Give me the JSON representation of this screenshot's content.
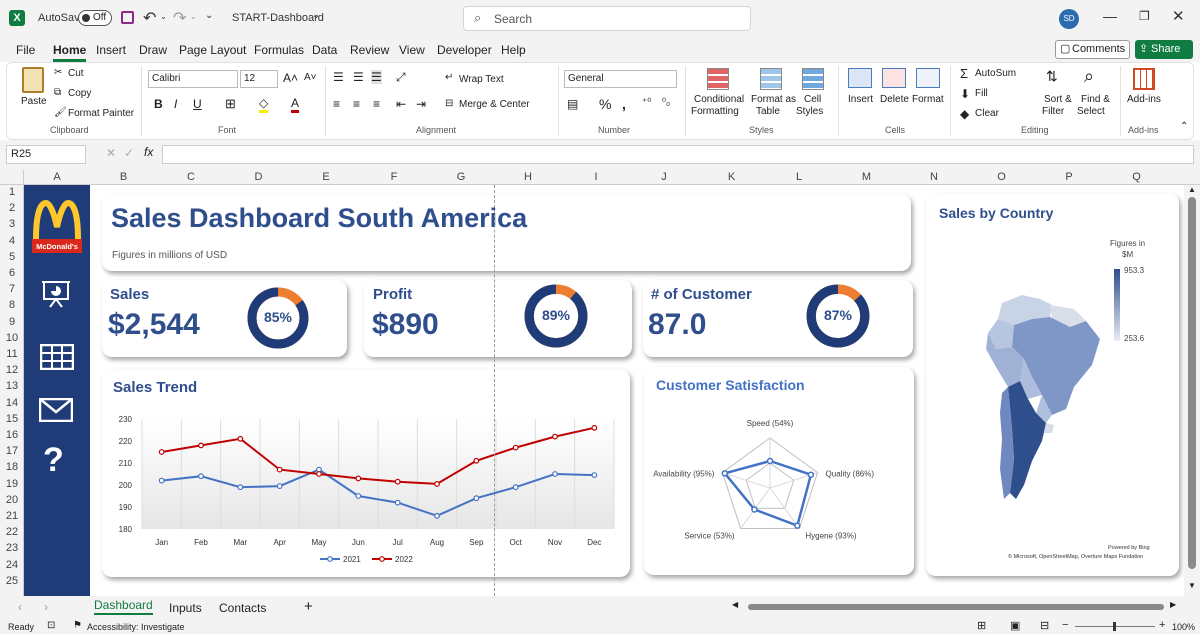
{
  "titlebar": {
    "autosave_label": "AutoSave",
    "autosave_state": "Off",
    "doc_title": "START-Dashboard",
    "search_placeholder": "Search",
    "user_initials": "SD"
  },
  "menu": [
    "File",
    "Home",
    "Insert",
    "Draw",
    "Page Layout",
    "Formulas",
    "Data",
    "Review",
    "View",
    "Developer",
    "Help"
  ],
  "menu_right": {
    "comments": "Comments",
    "share": "Share"
  },
  "ribbon": {
    "clipboard": {
      "paste": "Paste",
      "cut": "Cut",
      "copy": "Copy",
      "format_painter": "Format Painter",
      "group": "Clipboard"
    },
    "font": {
      "name": "Calibri",
      "size": "12",
      "group": "Font"
    },
    "alignment": {
      "wrap": "Wrap Text",
      "merge": "Merge & Center",
      "group": "Alignment"
    },
    "number": {
      "format": "General",
      "group": "Number"
    },
    "styles": {
      "conditional": "Conditional",
      "conditional2": "Formatting",
      "format_as": "Format as",
      "format_as2": "Table",
      "cell": "Cell",
      "cell2": "Styles",
      "group": "Styles"
    },
    "cells": {
      "insert": "Insert",
      "delete": "Delete",
      "format": "Format",
      "group": "Cells"
    },
    "editing": {
      "autosum": "AutoSum",
      "fill": "Fill",
      "clear": "Clear",
      "sort": "Sort &",
      "sort2": "Filter",
      "find": "Find &",
      "find2": "Select",
      "group": "Editing"
    },
    "addins": {
      "label": "Add-ins",
      "group": "Add-ins"
    }
  },
  "formula": {
    "namebox": "R25",
    "fx": "fx"
  },
  "columns": [
    "A",
    "B",
    "C",
    "D",
    "E",
    "F",
    "G",
    "H",
    "I",
    "J",
    "K",
    "L",
    "M",
    "N",
    "O",
    "P",
    "Q"
  ],
  "rows": [
    "1",
    "2",
    "3",
    "4",
    "5",
    "6",
    "7",
    "8",
    "9",
    "10",
    "11",
    "12",
    "13",
    "14",
    "15",
    "16",
    "17",
    "18",
    "19",
    "20",
    "21",
    "22",
    "23",
    "24",
    "25"
  ],
  "dashboard": {
    "logo_text": "McDonald's",
    "title": "Sales Dashboard South America",
    "subtitle": "Figures in millions of USD",
    "kpis": [
      {
        "title": "Sales",
        "value": "$2,544",
        "pct": "85%",
        "fraction": 0.85
      },
      {
        "title": "Profit",
        "value": "$890",
        "pct": "89%",
        "fraction": 0.89
      },
      {
        "title": "# of Customer",
        "value": "87.0",
        "pct": "87%",
        "fraction": 0.87
      }
    ],
    "colors": {
      "navy": "#1f3c78",
      "orange": "#ed7d31",
      "red": "#c00000",
      "blue": "#4472c4",
      "title": "#2f4e8c"
    },
    "sales_trend_title": "Sales Trend",
    "satisfaction_title": "Customer Satisfaction",
    "satisfaction_labels": [
      "Speed (54%)",
      "Quality (86%)",
      "Hygene (93%)",
      "Service (53%)",
      "Availability (95%)"
    ],
    "map_title": "Sales by Country",
    "map_legend_title": "Figures in",
    "map_legend_unit": "$M",
    "map_legend_max": "953.3",
    "map_legend_min": "253.6",
    "map_credit1": "Powered by Bing",
    "map_credit2": "© Microsoft, OpenStreetMap, Overture Maps Fundation"
  },
  "chart_data": [
    {
      "type": "line",
      "title": "Sales Trend",
      "categories": [
        "Jan",
        "Feb",
        "Mar",
        "Apr",
        "May",
        "Jun",
        "Jul",
        "Aug",
        "Sep",
        "Oct",
        "Nov",
        "Dec"
      ],
      "series": [
        {
          "name": "2021",
          "values": [
            202,
            204,
            199,
            199.5,
            207,
            195,
            192,
            186,
            194,
            199,
            205,
            204.5
          ]
        },
        {
          "name": "2022",
          "values": [
            215,
            218,
            221,
            207,
            205,
            203,
            201.5,
            200.5,
            211,
            217,
            222,
            226
          ]
        }
      ],
      "ylim": [
        180,
        230
      ],
      "yticks": [
        "180",
        "190",
        "200",
        "210",
        "220",
        "230"
      ],
      "legend": "bottom"
    },
    {
      "type": "radar",
      "title": "Customer Satisfaction",
      "categories": [
        "Speed",
        "Quality",
        "Hygene",
        "Service",
        "Availability"
      ],
      "values": [
        54,
        86,
        93,
        53,
        95
      ]
    }
  ],
  "sheet_tabs": [
    "Dashboard",
    "Inputs",
    "Contacts"
  ],
  "status": {
    "ready": "Ready",
    "accessibility": "Accessibility: Investigate",
    "zoom": "100%"
  }
}
